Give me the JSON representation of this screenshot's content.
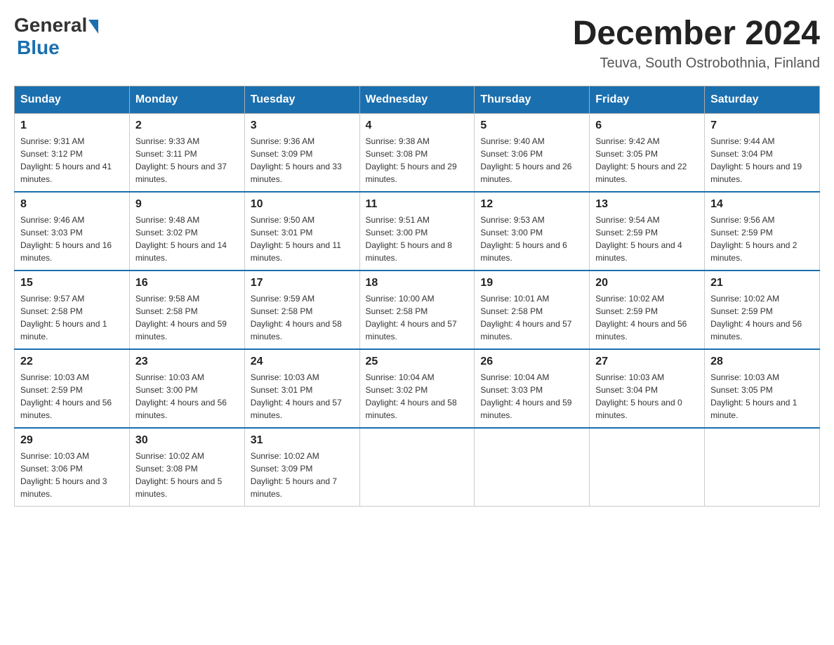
{
  "logo": {
    "general": "General",
    "blue": "Blue"
  },
  "title": "December 2024",
  "subtitle": "Teuva, South Ostrobothnia, Finland",
  "days_of_week": [
    "Sunday",
    "Monday",
    "Tuesday",
    "Wednesday",
    "Thursday",
    "Friday",
    "Saturday"
  ],
  "weeks": [
    [
      {
        "day": "1",
        "sunrise": "9:31 AM",
        "sunset": "3:12 PM",
        "daylight": "5 hours and 41 minutes."
      },
      {
        "day": "2",
        "sunrise": "9:33 AM",
        "sunset": "3:11 PM",
        "daylight": "5 hours and 37 minutes."
      },
      {
        "day": "3",
        "sunrise": "9:36 AM",
        "sunset": "3:09 PM",
        "daylight": "5 hours and 33 minutes."
      },
      {
        "day": "4",
        "sunrise": "9:38 AM",
        "sunset": "3:08 PM",
        "daylight": "5 hours and 29 minutes."
      },
      {
        "day": "5",
        "sunrise": "9:40 AM",
        "sunset": "3:06 PM",
        "daylight": "5 hours and 26 minutes."
      },
      {
        "day": "6",
        "sunrise": "9:42 AM",
        "sunset": "3:05 PM",
        "daylight": "5 hours and 22 minutes."
      },
      {
        "day": "7",
        "sunrise": "9:44 AM",
        "sunset": "3:04 PM",
        "daylight": "5 hours and 19 minutes."
      }
    ],
    [
      {
        "day": "8",
        "sunrise": "9:46 AM",
        "sunset": "3:03 PM",
        "daylight": "5 hours and 16 minutes."
      },
      {
        "day": "9",
        "sunrise": "9:48 AM",
        "sunset": "3:02 PM",
        "daylight": "5 hours and 14 minutes."
      },
      {
        "day": "10",
        "sunrise": "9:50 AM",
        "sunset": "3:01 PM",
        "daylight": "5 hours and 11 minutes."
      },
      {
        "day": "11",
        "sunrise": "9:51 AM",
        "sunset": "3:00 PM",
        "daylight": "5 hours and 8 minutes."
      },
      {
        "day": "12",
        "sunrise": "9:53 AM",
        "sunset": "3:00 PM",
        "daylight": "5 hours and 6 minutes."
      },
      {
        "day": "13",
        "sunrise": "9:54 AM",
        "sunset": "2:59 PM",
        "daylight": "5 hours and 4 minutes."
      },
      {
        "day": "14",
        "sunrise": "9:56 AM",
        "sunset": "2:59 PM",
        "daylight": "5 hours and 2 minutes."
      }
    ],
    [
      {
        "day": "15",
        "sunrise": "9:57 AM",
        "sunset": "2:58 PM",
        "daylight": "5 hours and 1 minute."
      },
      {
        "day": "16",
        "sunrise": "9:58 AM",
        "sunset": "2:58 PM",
        "daylight": "4 hours and 59 minutes."
      },
      {
        "day": "17",
        "sunrise": "9:59 AM",
        "sunset": "2:58 PM",
        "daylight": "4 hours and 58 minutes."
      },
      {
        "day": "18",
        "sunrise": "10:00 AM",
        "sunset": "2:58 PM",
        "daylight": "4 hours and 57 minutes."
      },
      {
        "day": "19",
        "sunrise": "10:01 AM",
        "sunset": "2:58 PM",
        "daylight": "4 hours and 57 minutes."
      },
      {
        "day": "20",
        "sunrise": "10:02 AM",
        "sunset": "2:59 PM",
        "daylight": "4 hours and 56 minutes."
      },
      {
        "day": "21",
        "sunrise": "10:02 AM",
        "sunset": "2:59 PM",
        "daylight": "4 hours and 56 minutes."
      }
    ],
    [
      {
        "day": "22",
        "sunrise": "10:03 AM",
        "sunset": "2:59 PM",
        "daylight": "4 hours and 56 minutes."
      },
      {
        "day": "23",
        "sunrise": "10:03 AM",
        "sunset": "3:00 PM",
        "daylight": "4 hours and 56 minutes."
      },
      {
        "day": "24",
        "sunrise": "10:03 AM",
        "sunset": "3:01 PM",
        "daylight": "4 hours and 57 minutes."
      },
      {
        "day": "25",
        "sunrise": "10:04 AM",
        "sunset": "3:02 PM",
        "daylight": "4 hours and 58 minutes."
      },
      {
        "day": "26",
        "sunrise": "10:04 AM",
        "sunset": "3:03 PM",
        "daylight": "4 hours and 59 minutes."
      },
      {
        "day": "27",
        "sunrise": "10:03 AM",
        "sunset": "3:04 PM",
        "daylight": "5 hours and 0 minutes."
      },
      {
        "day": "28",
        "sunrise": "10:03 AM",
        "sunset": "3:05 PM",
        "daylight": "5 hours and 1 minute."
      }
    ],
    [
      {
        "day": "29",
        "sunrise": "10:03 AM",
        "sunset": "3:06 PM",
        "daylight": "5 hours and 3 minutes."
      },
      {
        "day": "30",
        "sunrise": "10:02 AM",
        "sunset": "3:08 PM",
        "daylight": "5 hours and 5 minutes."
      },
      {
        "day": "31",
        "sunrise": "10:02 AM",
        "sunset": "3:09 PM",
        "daylight": "5 hours and 7 minutes."
      },
      null,
      null,
      null,
      null
    ]
  ]
}
